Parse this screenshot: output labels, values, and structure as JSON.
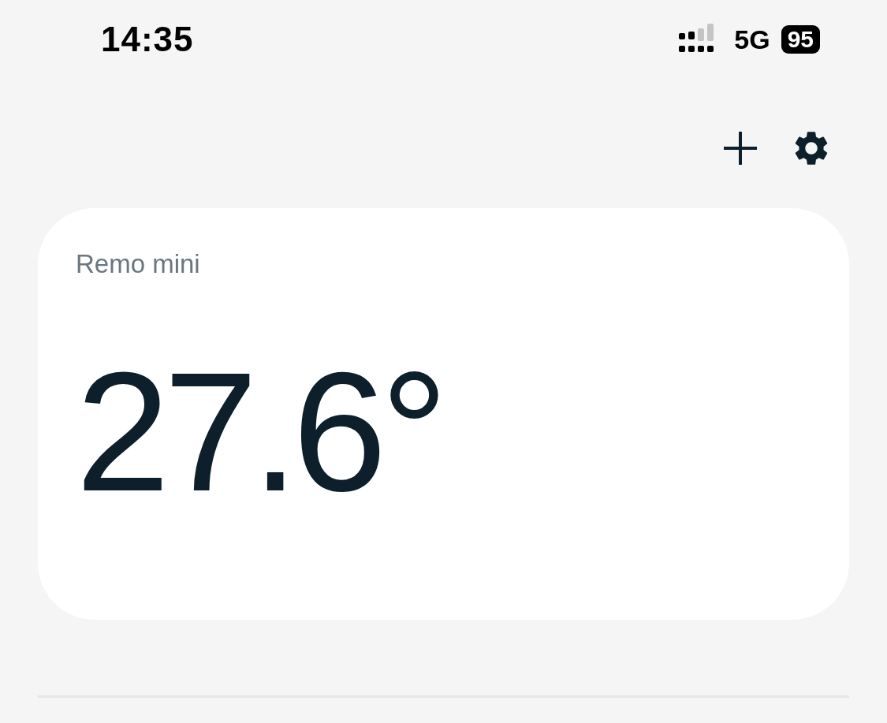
{
  "status_bar": {
    "time": "14:35",
    "network": "5G",
    "battery": "95"
  },
  "device_card": {
    "name": "Remo mini",
    "temperature": "27.6°"
  }
}
